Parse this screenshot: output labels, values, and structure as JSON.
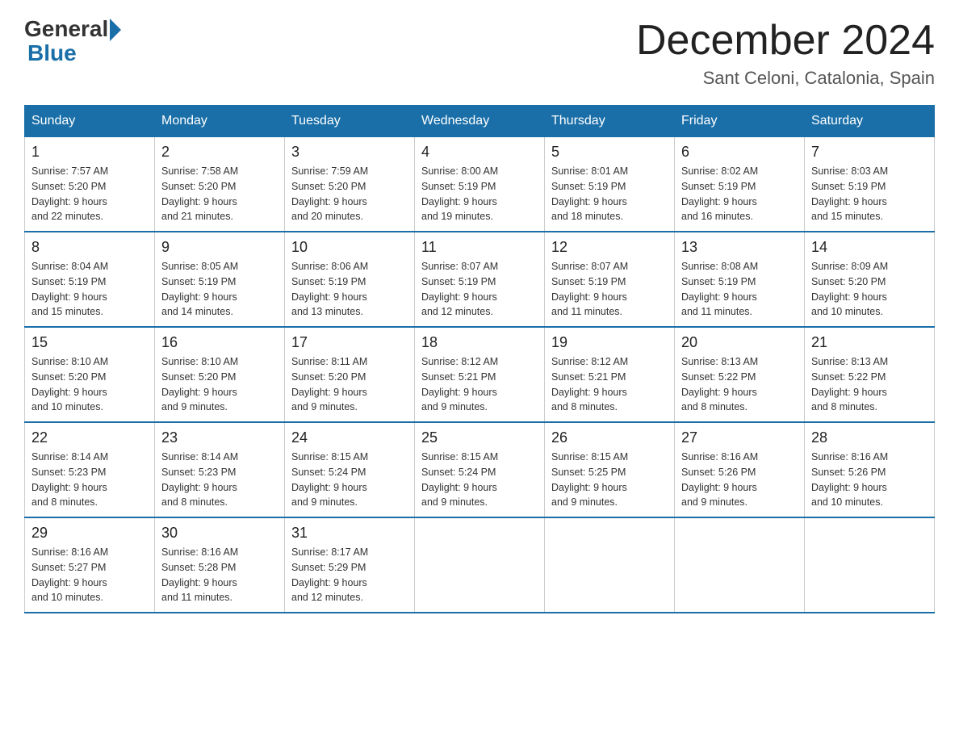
{
  "logo": {
    "general": "General",
    "blue": "Blue"
  },
  "title": "December 2024",
  "subtitle": "Sant Celoni, Catalonia, Spain",
  "days_of_week": [
    "Sunday",
    "Monday",
    "Tuesday",
    "Wednesday",
    "Thursday",
    "Friday",
    "Saturday"
  ],
  "weeks": [
    [
      {
        "day": "1",
        "sunrise": "7:57 AM",
        "sunset": "5:20 PM",
        "daylight": "9 hours and 22 minutes."
      },
      {
        "day": "2",
        "sunrise": "7:58 AM",
        "sunset": "5:20 PM",
        "daylight": "9 hours and 21 minutes."
      },
      {
        "day": "3",
        "sunrise": "7:59 AM",
        "sunset": "5:20 PM",
        "daylight": "9 hours and 20 minutes."
      },
      {
        "day": "4",
        "sunrise": "8:00 AM",
        "sunset": "5:19 PM",
        "daylight": "9 hours and 19 minutes."
      },
      {
        "day": "5",
        "sunrise": "8:01 AM",
        "sunset": "5:19 PM",
        "daylight": "9 hours and 18 minutes."
      },
      {
        "day": "6",
        "sunrise": "8:02 AM",
        "sunset": "5:19 PM",
        "daylight": "9 hours and 16 minutes."
      },
      {
        "day": "7",
        "sunrise": "8:03 AM",
        "sunset": "5:19 PM",
        "daylight": "9 hours and 15 minutes."
      }
    ],
    [
      {
        "day": "8",
        "sunrise": "8:04 AM",
        "sunset": "5:19 PM",
        "daylight": "9 hours and 15 minutes."
      },
      {
        "day": "9",
        "sunrise": "8:05 AM",
        "sunset": "5:19 PM",
        "daylight": "9 hours and 14 minutes."
      },
      {
        "day": "10",
        "sunrise": "8:06 AM",
        "sunset": "5:19 PM",
        "daylight": "9 hours and 13 minutes."
      },
      {
        "day": "11",
        "sunrise": "8:07 AM",
        "sunset": "5:19 PM",
        "daylight": "9 hours and 12 minutes."
      },
      {
        "day": "12",
        "sunrise": "8:07 AM",
        "sunset": "5:19 PM",
        "daylight": "9 hours and 11 minutes."
      },
      {
        "day": "13",
        "sunrise": "8:08 AM",
        "sunset": "5:19 PM",
        "daylight": "9 hours and 11 minutes."
      },
      {
        "day": "14",
        "sunrise": "8:09 AM",
        "sunset": "5:20 PM",
        "daylight": "9 hours and 10 minutes."
      }
    ],
    [
      {
        "day": "15",
        "sunrise": "8:10 AM",
        "sunset": "5:20 PM",
        "daylight": "9 hours and 10 minutes."
      },
      {
        "day": "16",
        "sunrise": "8:10 AM",
        "sunset": "5:20 PM",
        "daylight": "9 hours and 9 minutes."
      },
      {
        "day": "17",
        "sunrise": "8:11 AM",
        "sunset": "5:20 PM",
        "daylight": "9 hours and 9 minutes."
      },
      {
        "day": "18",
        "sunrise": "8:12 AM",
        "sunset": "5:21 PM",
        "daylight": "9 hours and 9 minutes."
      },
      {
        "day": "19",
        "sunrise": "8:12 AM",
        "sunset": "5:21 PM",
        "daylight": "9 hours and 8 minutes."
      },
      {
        "day": "20",
        "sunrise": "8:13 AM",
        "sunset": "5:22 PM",
        "daylight": "9 hours and 8 minutes."
      },
      {
        "day": "21",
        "sunrise": "8:13 AM",
        "sunset": "5:22 PM",
        "daylight": "9 hours and 8 minutes."
      }
    ],
    [
      {
        "day": "22",
        "sunrise": "8:14 AM",
        "sunset": "5:23 PM",
        "daylight": "9 hours and 8 minutes."
      },
      {
        "day": "23",
        "sunrise": "8:14 AM",
        "sunset": "5:23 PM",
        "daylight": "9 hours and 8 minutes."
      },
      {
        "day": "24",
        "sunrise": "8:15 AM",
        "sunset": "5:24 PM",
        "daylight": "9 hours and 9 minutes."
      },
      {
        "day": "25",
        "sunrise": "8:15 AM",
        "sunset": "5:24 PM",
        "daylight": "9 hours and 9 minutes."
      },
      {
        "day": "26",
        "sunrise": "8:15 AM",
        "sunset": "5:25 PM",
        "daylight": "9 hours and 9 minutes."
      },
      {
        "day": "27",
        "sunrise": "8:16 AM",
        "sunset": "5:26 PM",
        "daylight": "9 hours and 9 minutes."
      },
      {
        "day": "28",
        "sunrise": "8:16 AM",
        "sunset": "5:26 PM",
        "daylight": "9 hours and 10 minutes."
      }
    ],
    [
      {
        "day": "29",
        "sunrise": "8:16 AM",
        "sunset": "5:27 PM",
        "daylight": "9 hours and 10 minutes."
      },
      {
        "day": "30",
        "sunrise": "8:16 AM",
        "sunset": "5:28 PM",
        "daylight": "9 hours and 11 minutes."
      },
      {
        "day": "31",
        "sunrise": "8:17 AM",
        "sunset": "5:29 PM",
        "daylight": "9 hours and 12 minutes."
      },
      null,
      null,
      null,
      null
    ]
  ],
  "labels": {
    "sunrise": "Sunrise:",
    "sunset": "Sunset:",
    "daylight": "Daylight:"
  }
}
